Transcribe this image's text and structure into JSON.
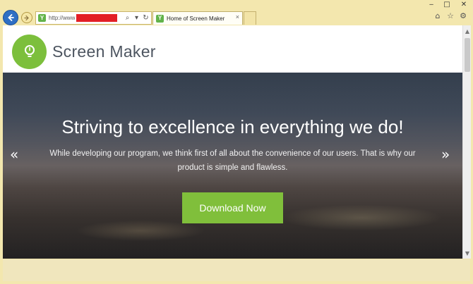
{
  "browser": {
    "address": {
      "url": "http://www"
    },
    "tab": {
      "title": "Home of Screen Maker"
    }
  },
  "site": {
    "brand": "Screen Maker",
    "hero": {
      "title": "Striving to excellence in everything we do!",
      "text": "While developing our program, we think first of all about the convenience of our users. That is why our product is simple and flawless.",
      "cta": "Download Now"
    }
  },
  "colors": {
    "accent": "#80bf3b",
    "redaction": "#e31f26",
    "frame": "#f3e7ae"
  },
  "icons": [
    "back-arrow-icon",
    "forward-arrow-icon",
    "search-icon",
    "dropdown-icon",
    "refresh-icon",
    "home-icon",
    "star-icon",
    "gear-icon",
    "lightbulb-icon",
    "chevron-left-icon",
    "chevron-right-icon"
  ]
}
